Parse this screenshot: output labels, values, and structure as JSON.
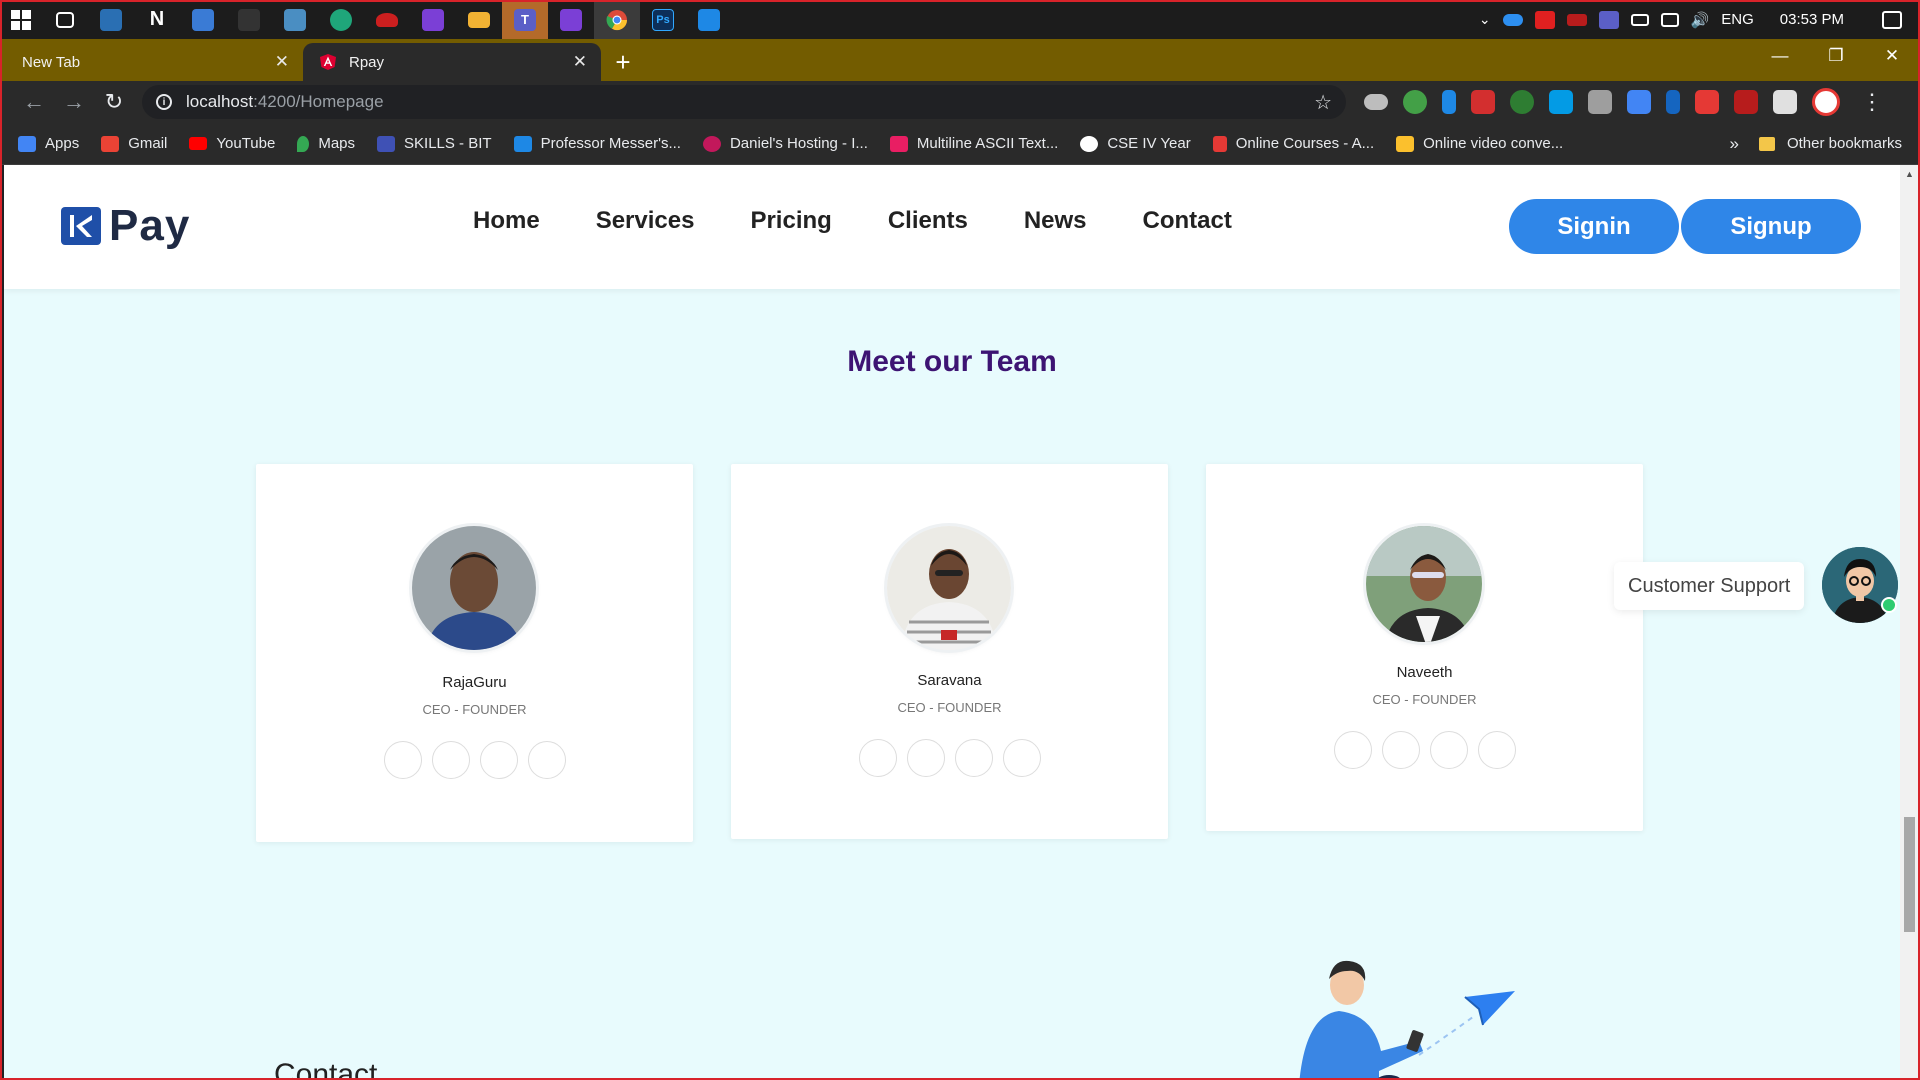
{
  "taskbar": {
    "apps": [
      {
        "icon": "task-view-icon",
        "color": "#1c1c1c"
      },
      {
        "icon": "remote-desktop-icon",
        "color": "#2a6fb3"
      },
      {
        "icon": "notion-icon",
        "color": "#1c1c1c"
      },
      {
        "icon": "app-window-icon",
        "color": "#3a7bd5"
      },
      {
        "icon": "blackberry-icon",
        "color": "#1c1c1c"
      },
      {
        "icon": "photos-icon",
        "color": "#4a8ec2"
      },
      {
        "icon": "edge-icon",
        "color": "#1fa67a"
      },
      {
        "icon": "red-hat-icon",
        "color": "#cc1f1f"
      },
      {
        "icon": "visual-studio-icon",
        "color": "#7b3fd6"
      },
      {
        "icon": "file-explorer-icon",
        "color": "#f2b233"
      },
      {
        "icon": "teams-icon",
        "color": "#5b5fc7"
      },
      {
        "icon": "visual-studio-icon",
        "color": "#7b3fd6"
      },
      {
        "icon": "chrome-icon",
        "color": "#dd4b39"
      },
      {
        "icon": "photoshop-icon",
        "color": "#0d2f59"
      },
      {
        "icon": "vscode-icon",
        "color": "#1e88e5"
      }
    ],
    "tray": {
      "language": "ENG",
      "time": "03:53 PM"
    }
  },
  "browser": {
    "tabs": [
      {
        "title": "New Tab",
        "active": false
      },
      {
        "title": "Rpay",
        "active": true
      }
    ],
    "url_host": "localhost",
    "url_path": ":4200/Homepage",
    "bookmarks": [
      {
        "label": "Apps",
        "color": "#4285f4"
      },
      {
        "label": "Gmail",
        "color": "#ea4335"
      },
      {
        "label": "YouTube",
        "color": "#ff0000"
      },
      {
        "label": "Maps",
        "color": "#34a853"
      },
      {
        "label": "SKILLS - BIT",
        "color": "#3f51b5"
      },
      {
        "label": "Professor Messer's...",
        "color": "#1e88e5"
      },
      {
        "label": "Daniel's Hosting - I...",
        "color": "#c2185b"
      },
      {
        "label": "Multiline ASCII Text...",
        "color": "#e91e63"
      },
      {
        "label": "CSE IV Year",
        "color": "#ffffff"
      },
      {
        "label": "Online Courses - A...",
        "color": "#e53935"
      },
      {
        "label": "Online video conve...",
        "color": "#fbc02d"
      }
    ],
    "bookmarks_more": "»",
    "other_bookmarks": "Other bookmarks"
  },
  "site": {
    "logo_text": "Pay",
    "nav": [
      "Home",
      "Services",
      "Pricing",
      "Clients",
      "News",
      "Contact"
    ],
    "signin": "Signin",
    "signup": "Signup",
    "team_title": "Meet our Team",
    "members": [
      {
        "name": "RajaGuru",
        "role": "CEO - FOUNDER"
      },
      {
        "name": "Saravana",
        "role": "CEO - FOUNDER"
      },
      {
        "name": "Naveeth",
        "role": "CEO - FOUNDER"
      }
    ],
    "support_label": "Customer Support",
    "contact_heading": "Contact"
  },
  "colors": {
    "page_bg": "#e8fbfd",
    "accent": "#2f86e8",
    "team_title": "#3d1473",
    "tab_strip": "#735c00"
  }
}
